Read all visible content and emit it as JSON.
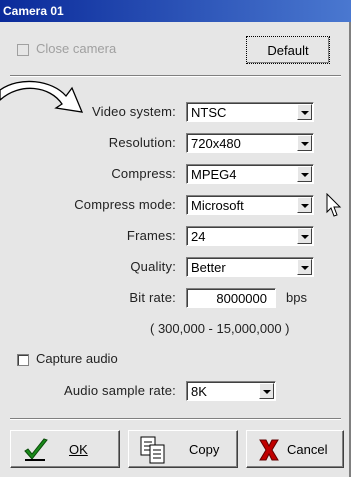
{
  "window": {
    "title": "Camera 01"
  },
  "top": {
    "close_camera_label": "Close camera",
    "default_button": "Default"
  },
  "form": {
    "video_system": {
      "label": "Video system:",
      "value": "NTSC"
    },
    "resolution": {
      "label": "Resolution:",
      "value": "720x480"
    },
    "compress": {
      "label": "Compress:",
      "value": "MPEG4"
    },
    "compress_mode": {
      "label": "Compress mode:",
      "value": "Microsoft"
    },
    "frames": {
      "label": "Frames:",
      "value": "24"
    },
    "quality": {
      "label": "Quality:",
      "value": "Better"
    },
    "bit_rate": {
      "label": "Bit rate:",
      "value": "8000000",
      "unit": "bps",
      "range": "( 300,000 - 15,000,000 )"
    }
  },
  "audio": {
    "capture_label": "Capture audio",
    "sample_rate_label": "Audio sample rate:",
    "sample_rate_value": "8K"
  },
  "buttons": {
    "ok": "OK",
    "copy": "Copy",
    "cancel": "Cancel"
  }
}
